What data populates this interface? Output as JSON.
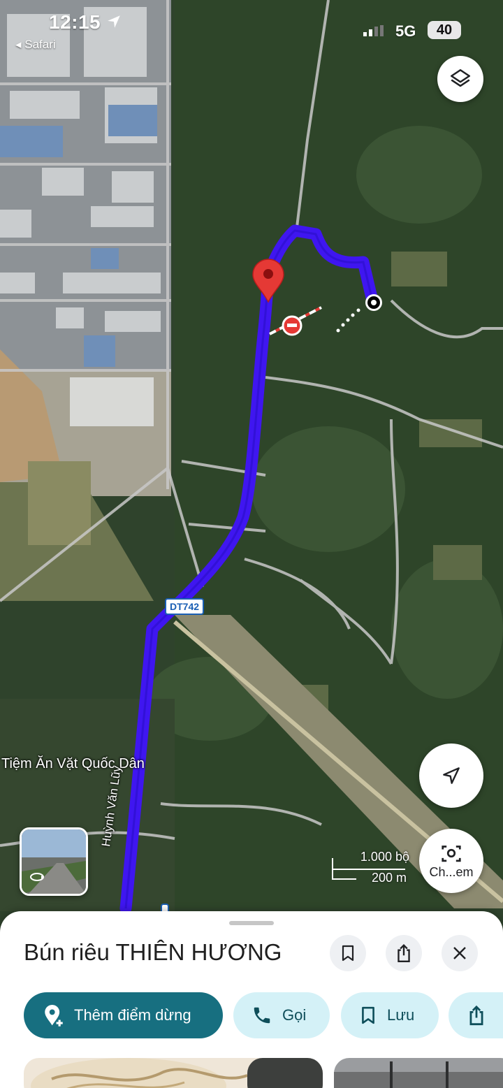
{
  "status_bar": {
    "time": "12:15",
    "back_app": "◂ Safari",
    "network": "5G",
    "battery": "40"
  },
  "map": {
    "labels": {
      "place": "Tiệm Ăn Vặt Quốc Dân",
      "road_shield": "DT742",
      "street": "Huỳnh Văn Lũy"
    },
    "scale": {
      "imperial": "1.000 bộ",
      "metric": "200 m"
    },
    "route_color": "#3f16f0",
    "pin_color": "#e53935"
  },
  "controls": {
    "layers_icon": "layers-icon",
    "locate_icon": "navigation-arrow-icon",
    "search_image_label": "Ch...em"
  },
  "place_sheet": {
    "title": "Bún riêu THIÊN HƯƠNG",
    "actions": [
      "bookmark-icon",
      "share-icon",
      "close-icon"
    ],
    "chips": [
      {
        "label": "Thêm điểm dừng",
        "icon": "add-location-icon"
      },
      {
        "label": "Gọi",
        "icon": "phone-icon"
      },
      {
        "label": "Lưu",
        "icon": "bookmark-icon"
      },
      {
        "label": "",
        "icon": "share-icon"
      }
    ],
    "accent": "#176f80",
    "chip_bg": "#d4f1f7"
  }
}
